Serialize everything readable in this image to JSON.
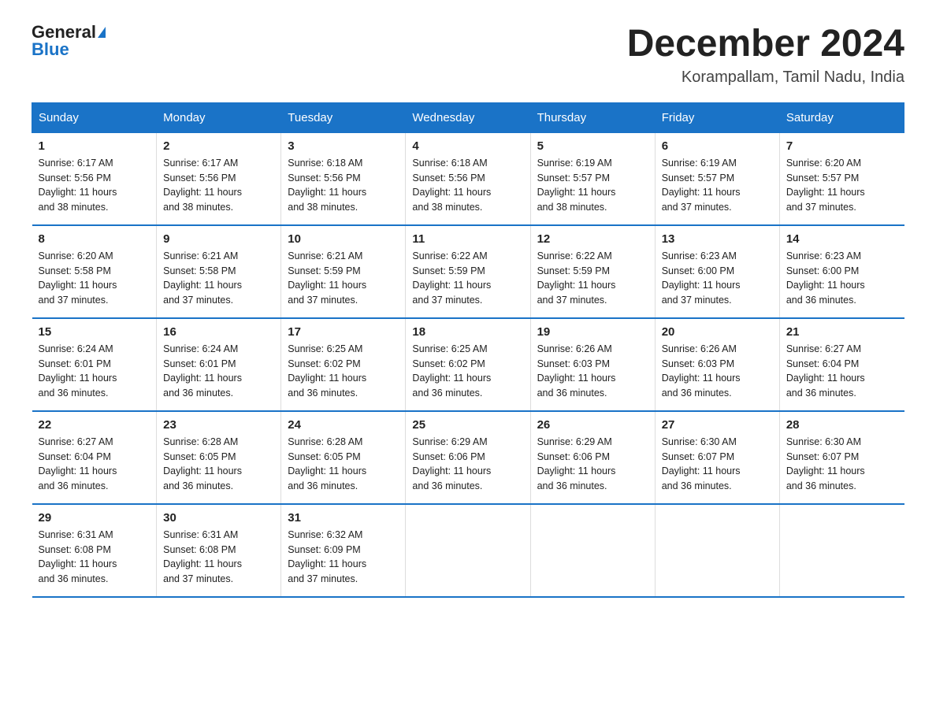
{
  "logo": {
    "general": "General",
    "blue": "Blue"
  },
  "title": "December 2024",
  "location": "Korampallam, Tamil Nadu, India",
  "headers": [
    "Sunday",
    "Monday",
    "Tuesday",
    "Wednesday",
    "Thursday",
    "Friday",
    "Saturday"
  ],
  "weeks": [
    [
      {
        "day": "1",
        "info": "Sunrise: 6:17 AM\nSunset: 5:56 PM\nDaylight: 11 hours\nand 38 minutes."
      },
      {
        "day": "2",
        "info": "Sunrise: 6:17 AM\nSunset: 5:56 PM\nDaylight: 11 hours\nand 38 minutes."
      },
      {
        "day": "3",
        "info": "Sunrise: 6:18 AM\nSunset: 5:56 PM\nDaylight: 11 hours\nand 38 minutes."
      },
      {
        "day": "4",
        "info": "Sunrise: 6:18 AM\nSunset: 5:56 PM\nDaylight: 11 hours\nand 38 minutes."
      },
      {
        "day": "5",
        "info": "Sunrise: 6:19 AM\nSunset: 5:57 PM\nDaylight: 11 hours\nand 38 minutes."
      },
      {
        "day": "6",
        "info": "Sunrise: 6:19 AM\nSunset: 5:57 PM\nDaylight: 11 hours\nand 37 minutes."
      },
      {
        "day": "7",
        "info": "Sunrise: 6:20 AM\nSunset: 5:57 PM\nDaylight: 11 hours\nand 37 minutes."
      }
    ],
    [
      {
        "day": "8",
        "info": "Sunrise: 6:20 AM\nSunset: 5:58 PM\nDaylight: 11 hours\nand 37 minutes."
      },
      {
        "day": "9",
        "info": "Sunrise: 6:21 AM\nSunset: 5:58 PM\nDaylight: 11 hours\nand 37 minutes."
      },
      {
        "day": "10",
        "info": "Sunrise: 6:21 AM\nSunset: 5:59 PM\nDaylight: 11 hours\nand 37 minutes."
      },
      {
        "day": "11",
        "info": "Sunrise: 6:22 AM\nSunset: 5:59 PM\nDaylight: 11 hours\nand 37 minutes."
      },
      {
        "day": "12",
        "info": "Sunrise: 6:22 AM\nSunset: 5:59 PM\nDaylight: 11 hours\nand 37 minutes."
      },
      {
        "day": "13",
        "info": "Sunrise: 6:23 AM\nSunset: 6:00 PM\nDaylight: 11 hours\nand 37 minutes."
      },
      {
        "day": "14",
        "info": "Sunrise: 6:23 AM\nSunset: 6:00 PM\nDaylight: 11 hours\nand 36 minutes."
      }
    ],
    [
      {
        "day": "15",
        "info": "Sunrise: 6:24 AM\nSunset: 6:01 PM\nDaylight: 11 hours\nand 36 minutes."
      },
      {
        "day": "16",
        "info": "Sunrise: 6:24 AM\nSunset: 6:01 PM\nDaylight: 11 hours\nand 36 minutes."
      },
      {
        "day": "17",
        "info": "Sunrise: 6:25 AM\nSunset: 6:02 PM\nDaylight: 11 hours\nand 36 minutes."
      },
      {
        "day": "18",
        "info": "Sunrise: 6:25 AM\nSunset: 6:02 PM\nDaylight: 11 hours\nand 36 minutes."
      },
      {
        "day": "19",
        "info": "Sunrise: 6:26 AM\nSunset: 6:03 PM\nDaylight: 11 hours\nand 36 minutes."
      },
      {
        "day": "20",
        "info": "Sunrise: 6:26 AM\nSunset: 6:03 PM\nDaylight: 11 hours\nand 36 minutes."
      },
      {
        "day": "21",
        "info": "Sunrise: 6:27 AM\nSunset: 6:04 PM\nDaylight: 11 hours\nand 36 minutes."
      }
    ],
    [
      {
        "day": "22",
        "info": "Sunrise: 6:27 AM\nSunset: 6:04 PM\nDaylight: 11 hours\nand 36 minutes."
      },
      {
        "day": "23",
        "info": "Sunrise: 6:28 AM\nSunset: 6:05 PM\nDaylight: 11 hours\nand 36 minutes."
      },
      {
        "day": "24",
        "info": "Sunrise: 6:28 AM\nSunset: 6:05 PM\nDaylight: 11 hours\nand 36 minutes."
      },
      {
        "day": "25",
        "info": "Sunrise: 6:29 AM\nSunset: 6:06 PM\nDaylight: 11 hours\nand 36 minutes."
      },
      {
        "day": "26",
        "info": "Sunrise: 6:29 AM\nSunset: 6:06 PM\nDaylight: 11 hours\nand 36 minutes."
      },
      {
        "day": "27",
        "info": "Sunrise: 6:30 AM\nSunset: 6:07 PM\nDaylight: 11 hours\nand 36 minutes."
      },
      {
        "day": "28",
        "info": "Sunrise: 6:30 AM\nSunset: 6:07 PM\nDaylight: 11 hours\nand 36 minutes."
      }
    ],
    [
      {
        "day": "29",
        "info": "Sunrise: 6:31 AM\nSunset: 6:08 PM\nDaylight: 11 hours\nand 36 minutes."
      },
      {
        "day": "30",
        "info": "Sunrise: 6:31 AM\nSunset: 6:08 PM\nDaylight: 11 hours\nand 37 minutes."
      },
      {
        "day": "31",
        "info": "Sunrise: 6:32 AM\nSunset: 6:09 PM\nDaylight: 11 hours\nand 37 minutes."
      },
      {
        "day": "",
        "info": ""
      },
      {
        "day": "",
        "info": ""
      },
      {
        "day": "",
        "info": ""
      },
      {
        "day": "",
        "info": ""
      }
    ]
  ]
}
